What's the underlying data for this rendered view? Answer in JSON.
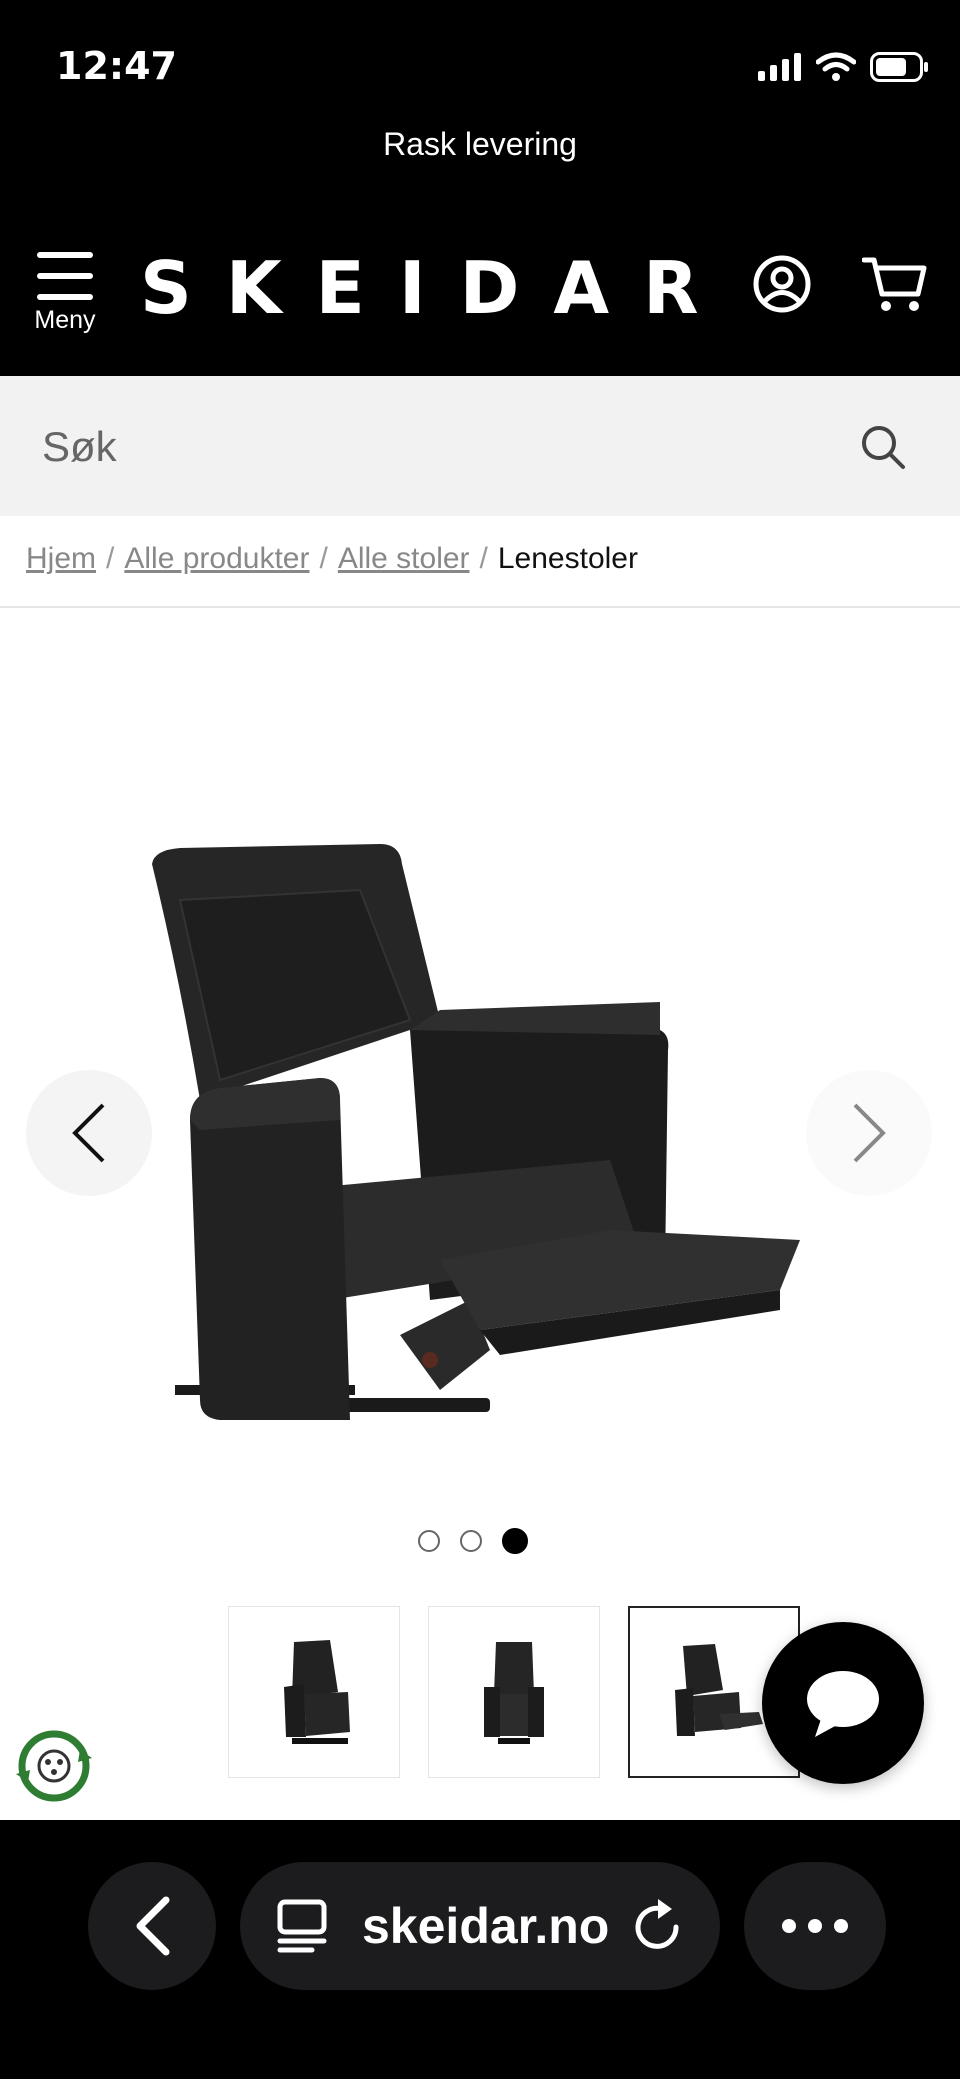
{
  "status_bar": {
    "time": "12:47"
  },
  "promo": {
    "text": "Rask levering"
  },
  "header": {
    "menu_label": "Meny",
    "logo": "SKEIDAR"
  },
  "search": {
    "placeholder": "Søk"
  },
  "breadcrumb": {
    "items": [
      "Hjem",
      "Alle produkter",
      "Alle stoler"
    ],
    "current": "Lenestoler",
    "separator": "/"
  },
  "gallery": {
    "slide_count": 3,
    "active_slide": 3,
    "thumbnails": 3,
    "active_thumbnail": 3
  },
  "browser": {
    "url": "skeidar.no"
  },
  "colors": {
    "header_bg": "#000000",
    "search_bg": "#f2f2f2",
    "eco_green": "#2e7d32"
  },
  "icons": [
    "hamburger-icon",
    "account-icon",
    "cart-icon",
    "search-icon",
    "chevron-left-icon",
    "chevron-right-icon",
    "chat-bubble-icon",
    "eco-badge-icon",
    "back-icon",
    "tabs-icon",
    "reload-icon",
    "more-icon"
  ]
}
